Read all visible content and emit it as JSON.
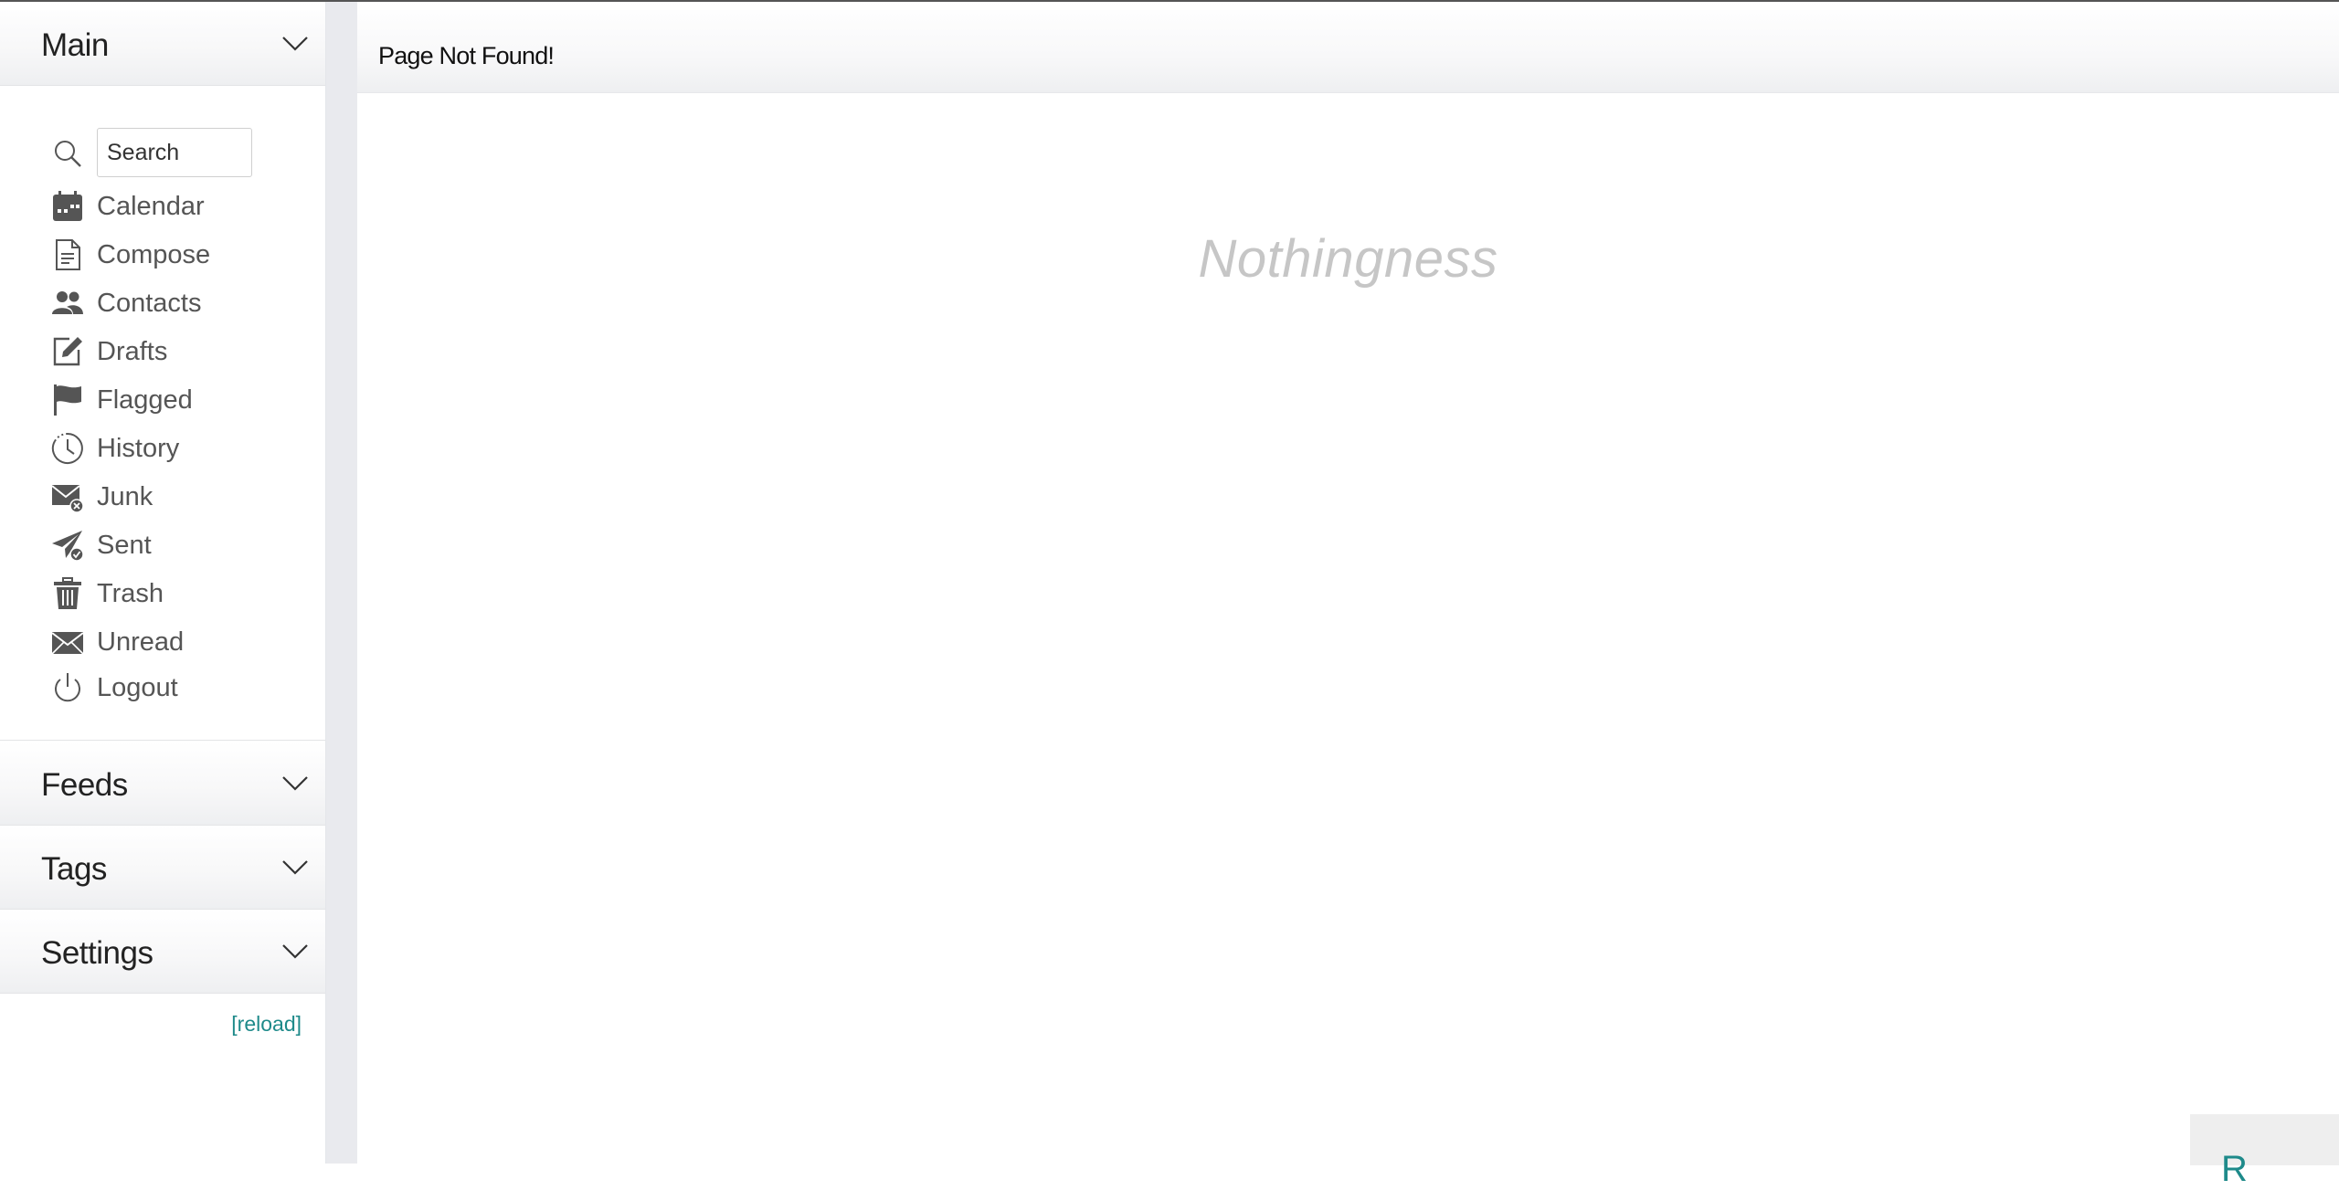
{
  "sidebar": {
    "sections": {
      "main": "Main",
      "feeds": "Feeds",
      "tags": "Tags",
      "settings": "Settings"
    },
    "search": {
      "placeholder": "Search",
      "value": ""
    },
    "items": [
      {
        "label": "Calendar",
        "icon": "calendar-icon"
      },
      {
        "label": "Compose",
        "icon": "compose-icon"
      },
      {
        "label": "Contacts",
        "icon": "contacts-icon"
      },
      {
        "label": "Drafts",
        "icon": "drafts-icon"
      },
      {
        "label": "Flagged",
        "icon": "flag-icon"
      },
      {
        "label": "History",
        "icon": "history-icon"
      },
      {
        "label": "Junk",
        "icon": "junk-icon"
      },
      {
        "label": "Sent",
        "icon": "sent-icon"
      },
      {
        "label": "Trash",
        "icon": "trash-icon"
      },
      {
        "label": "Unread",
        "icon": "unread-icon"
      },
      {
        "label": "Logout",
        "icon": "logout-icon"
      }
    ],
    "reload_label": "[reload]"
  },
  "main": {
    "title": "Page Not Found!",
    "empty_message": "Nothingness"
  },
  "colors": {
    "accent": "#1e8a8a",
    "icon": "#555555",
    "muted_text": "#c6c6c6"
  }
}
